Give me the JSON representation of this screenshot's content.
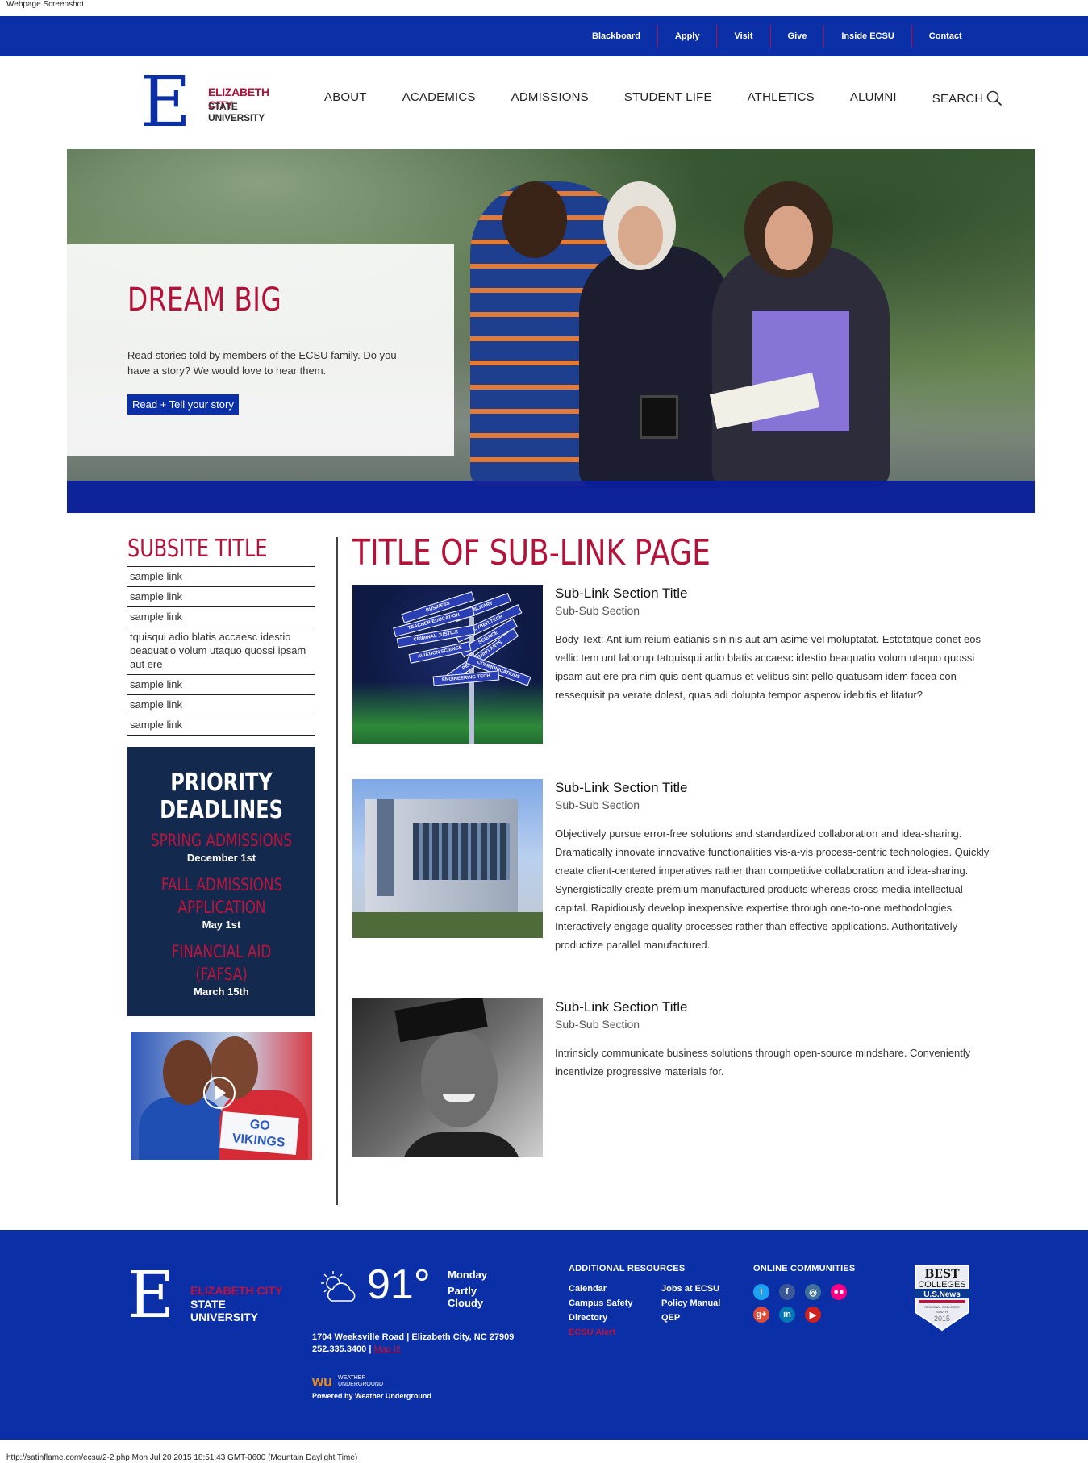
{
  "capture": {
    "top": "Webpage Screenshot",
    "bottom": "http://satinflame.com/ecsu/2-2.php Mon Jul 20 2015 18:51:43 GMT-0600 (Mountain Daylight Time)"
  },
  "utility_nav": [
    "Blackboard",
    "Apply",
    "Visit",
    "Give",
    "Inside ECSU",
    "Contact"
  ],
  "logo": {
    "letter": "E",
    "line1": "ELIZABETH CITY",
    "line2": "STATE UNIVERSITY"
  },
  "main_nav": [
    "ABOUT",
    "ACADEMICS",
    "ADMISSIONS",
    "STUDENT LIFE",
    "ATHLETICS",
    "ALUMNI"
  ],
  "search_label": "SEARCH",
  "hero": {
    "title": "DREAM BIG",
    "text": "Read stories told by members of the ECSU family. Do you have a story? We would love to hear them.",
    "cta": "Read + Tell your story"
  },
  "sidebar": {
    "title": "SUBSITE TITLE",
    "links": [
      "sample link",
      "sample link",
      "sample link",
      "tquisqui adio blatis accaesc idestio beaquatio volum utaquo quossi ipsam aut ere",
      "sample link",
      "sample link",
      "sample link"
    ],
    "deadlines": {
      "heading1": "PRIORITY",
      "heading2": "DEADLINES",
      "items": [
        {
          "label": "SPRING ADMISSIONS",
          "date": "December 1st"
        },
        {
          "label": "FALL ADMISSIONS APPLICATION",
          "date": "May 1st"
        },
        {
          "label": "FINANCIAL AID (FAFSA)",
          "date": "March 15th"
        }
      ]
    },
    "promo_sign": "GO VIKINGS"
  },
  "page": {
    "title": "TITLE OF SUB-LINK PAGE",
    "sections": [
      {
        "title": "Sub-Link Section Title",
        "subtitle": "Sub-Sub Section",
        "body": "Body Text: Ant ium reium eatianis sin nis aut am asime vel moluptatat. Estotatque conet eos vellic tem unt laborup tatquisqui adio blatis accaesc idestio beaquatio volum utaquo quossi ipsam aut ere pra nim quis dent quamus et velibus sint pello quatusam idem facea con ressequisit pa verate dolest, quas adi dolupta tempor asperov idebitis et litatur?",
        "signs": [
          "BUSINESS",
          "MILITARY",
          "TEACHER EDUCATION",
          "CYBER TECH",
          "CRIMINAL JUSTICE",
          "SCIENCE",
          "AVIATION SCIENCE",
          "PERFORMING ARTS",
          "COMMUNICATIONS",
          "ENGINEERING TECH"
        ]
      },
      {
        "title": "Sub-Link Section Title",
        "subtitle": "Sub-Sub Section",
        "body": "Objectively pursue error-free solutions and standardized collaboration and idea-sharing. Dramatically innovate innovative functionalities vis-a-vis process-centric technologies. Quickly create client-centered imperatives rather than competitive collaboration and idea-sharing. Synergistically create premium manufactured products whereas cross-media intellectual capital. Rapidiously develop inexpensive expertise through one-to-one methodologies. Interactively engage quality processes rather than effective applications. Authoritatively productize parallel manufactured."
      },
      {
        "title": "Sub-Link Section Title",
        "subtitle": "Sub-Sub Section",
        "body": "Intrinsicly communicate business solutions through open-source mindshare. Conveniently incentivize progressive materials for."
      }
    ]
  },
  "footer": {
    "weather": {
      "temp": "91°",
      "day": "Monday",
      "condition": "Partly Cloudy"
    },
    "address": "1704 Weeksville Road",
    "city": "Elizabeth City, NC 27909",
    "phone": "252.335.3400",
    "map_link": "Map It!",
    "wu": {
      "mark": "wu",
      "line1": "WEATHER",
      "line2": "UNDERGROUND",
      "powered": "Powered by Weather Underground"
    },
    "resources_title": "ADDITIONAL RESOURCES",
    "resources": [
      "Calendar",
      "Jobs at ECSU",
      "Campus Safety",
      "Policy Manual",
      "Directory",
      "QEP",
      "ECSU Alert"
    ],
    "communities_title": "ONLINE COMMUNITIES",
    "social": [
      {
        "name": "twitter-icon",
        "glyph": "t",
        "color": "#1da1f2"
      },
      {
        "name": "facebook-icon",
        "glyph": "f",
        "color": "#3b5998"
      },
      {
        "name": "instagram-icon",
        "glyph": "◎",
        "color": "#3f729b"
      },
      {
        "name": "flickr-icon",
        "glyph": "●●",
        "color": "#ff0084"
      },
      {
        "name": "googleplus-icon",
        "glyph": "g+",
        "color": "#dd4b39"
      },
      {
        "name": "linkedin-icon",
        "glyph": "in",
        "color": "#0077b5"
      },
      {
        "name": "youtube-icon",
        "glyph": "▶",
        "color": "#cd201f"
      }
    ],
    "badge": {
      "l1": "BEST",
      "l2": "COLLEGES",
      "l3": "U.S.News",
      "l4": "REGIONAL COLLEGES",
      "l5": "SOUTH",
      "l6": "2015"
    }
  }
}
